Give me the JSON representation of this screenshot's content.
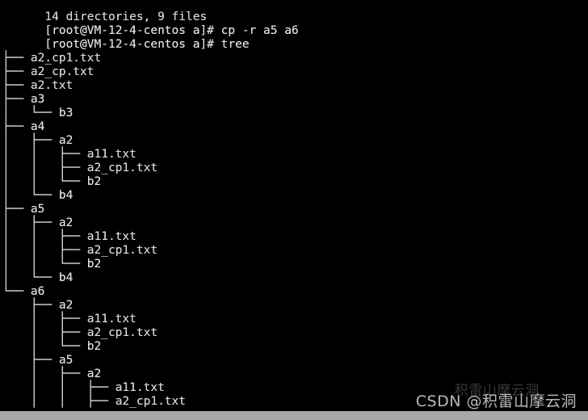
{
  "terminal": {
    "prompt": "[root@VM-12-4-centos a]#",
    "scrollback_top": "14 directories, 9 files",
    "commands": [
      {
        "prompt": "[root@VM-12-4-centos a]#",
        "command": " cp -r a5 a6"
      },
      {
        "prompt": "[root@VM-12-4-centos a]#",
        "command": " tree"
      }
    ],
    "tree_root": ".",
    "tree_lines": [
      {
        "prefix": "├── ",
        "name": "a2_cp1.txt",
        "kind": "file"
      },
      {
        "prefix": "├── ",
        "name": "a2_cp.txt",
        "kind": "file"
      },
      {
        "prefix": "├── ",
        "name": "a2.txt",
        "kind": "file"
      },
      {
        "prefix": "├── ",
        "name": "a3",
        "kind": "dir"
      },
      {
        "prefix": "│   └── ",
        "name": "b3",
        "kind": "dir"
      },
      {
        "prefix": "├── ",
        "name": "a4",
        "kind": "dir"
      },
      {
        "prefix": "│   ├── ",
        "name": "a2",
        "kind": "dir"
      },
      {
        "prefix": "│   │   ├── ",
        "name": "a11.txt",
        "kind": "file"
      },
      {
        "prefix": "│   │   ├── ",
        "name": "a2_cp1.txt",
        "kind": "file"
      },
      {
        "prefix": "│   │   └── ",
        "name": "b2",
        "kind": "dir"
      },
      {
        "prefix": "│   └── ",
        "name": "b4",
        "kind": "dir"
      },
      {
        "prefix": "├── ",
        "name": "a5",
        "kind": "dir"
      },
      {
        "prefix": "│   ├── ",
        "name": "a2",
        "kind": "dir"
      },
      {
        "prefix": "│   │   ├── ",
        "name": "a11.txt",
        "kind": "file"
      },
      {
        "prefix": "│   │   ├── ",
        "name": "a2_cp1.txt",
        "kind": "file"
      },
      {
        "prefix": "│   │   └── ",
        "name": "b2",
        "kind": "dir"
      },
      {
        "prefix": "│   └── ",
        "name": "b4",
        "kind": "dir"
      },
      {
        "prefix": "└── ",
        "name": "a6",
        "kind": "dir"
      },
      {
        "prefix": "    ├── ",
        "name": "a2",
        "kind": "dir"
      },
      {
        "prefix": "    │   ├── ",
        "name": "a11.txt",
        "kind": "file"
      },
      {
        "prefix": "    │   ├── ",
        "name": "a2_cp1.txt",
        "kind": "file"
      },
      {
        "prefix": "    │   └── ",
        "name": "b2",
        "kind": "dir"
      },
      {
        "prefix": "    ├── ",
        "name": "a5",
        "kind": "dir"
      },
      {
        "prefix": "    │   ├── ",
        "name": "a2",
        "kind": "dir"
      },
      {
        "prefix": "    │   │   ├── ",
        "name": "a11.txt",
        "kind": "file"
      },
      {
        "prefix": "    │   │   ├── ",
        "name": "a2_cp1.txt",
        "kind": "file"
      }
    ]
  },
  "watermark": {
    "text": "CSDN @积雷山摩云洞",
    "ghost_text": "积雷山摩云洞"
  },
  "colors": {
    "background": "#000000",
    "foreground": "#d8d8d8",
    "statusbar": "#a8a8a8"
  }
}
